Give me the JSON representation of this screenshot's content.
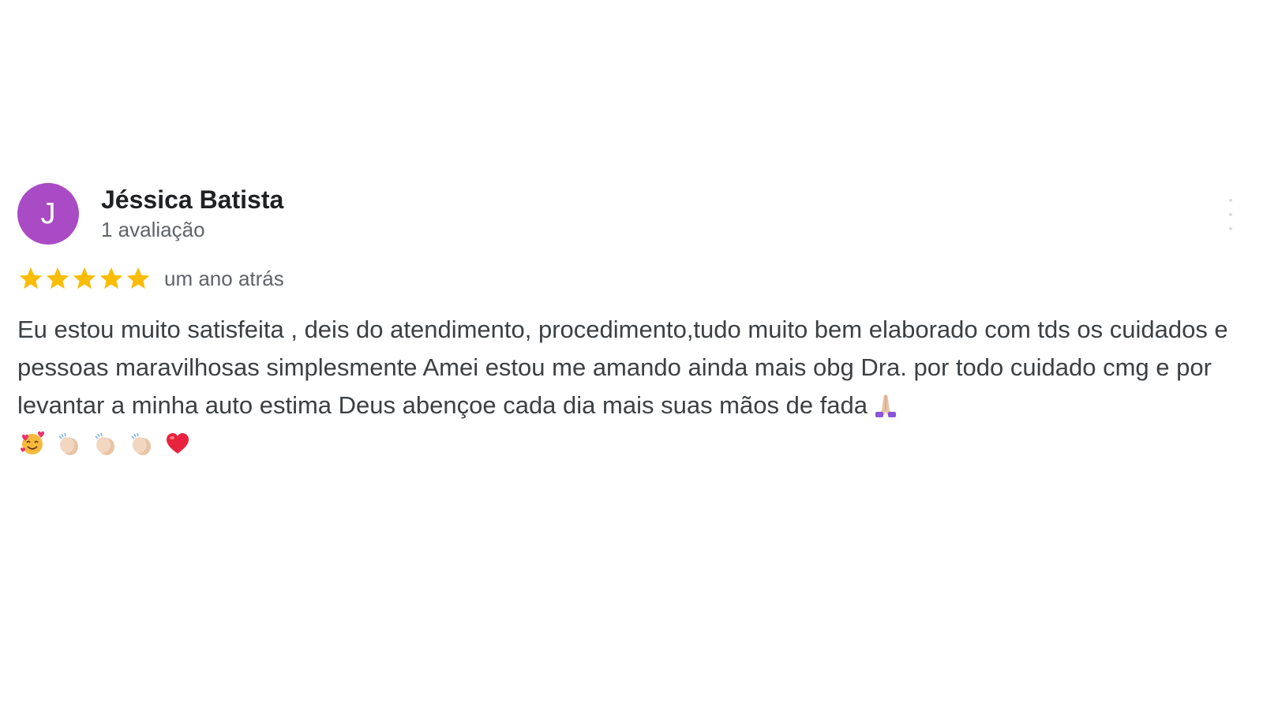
{
  "review": {
    "avatar_letter": "J",
    "avatar_color": "#a94bc4",
    "author_name": "Jéssica Batista",
    "author_reviews": "1 avaliação",
    "rating": 5,
    "rating_max": 5,
    "star_color": "#fbbc04",
    "time_ago": "um ano atrás",
    "text": "Eu estou muito satisfeita , deis do atendimento, procedimento,tudo muito bem elaborado com tds os cuidados e pessoas maravilhosas simplesmente Amei estou me amando ainda mais obg Dra. por todo cuidado cmg e por levantar a minha auto estima Deus abençoe cada dia mais suas mãos de fada",
    "emojis": [
      "praying-hands-icon",
      "smiling-face-with-hearts-icon",
      "clapping-hands-icon",
      "clapping-hands-icon",
      "clapping-hands-icon",
      "red-heart-icon"
    ]
  },
  "menu": {
    "icon": "more-vert-icon"
  }
}
